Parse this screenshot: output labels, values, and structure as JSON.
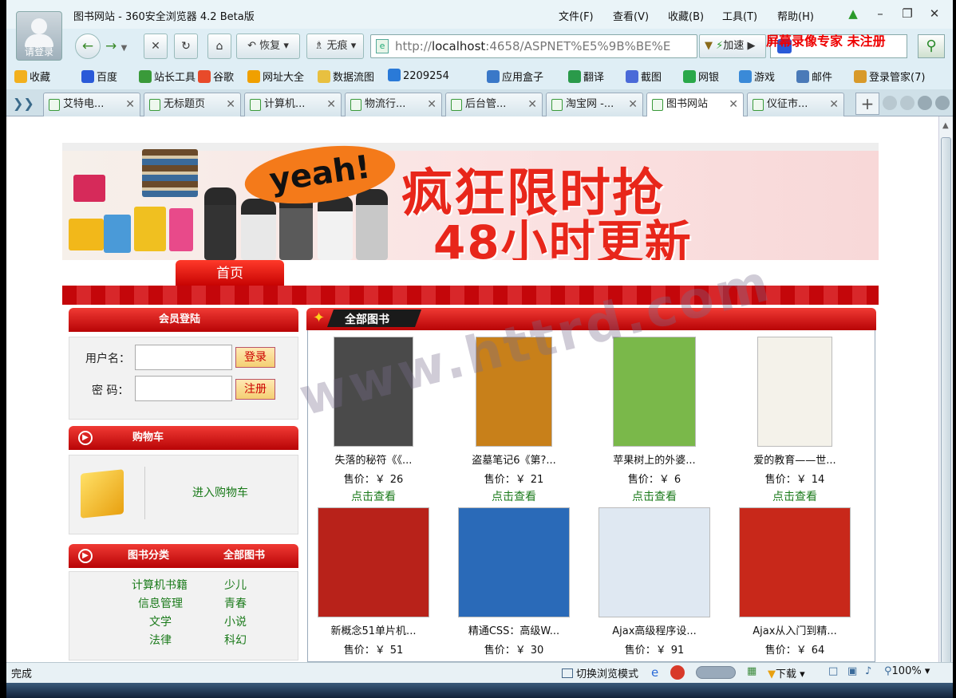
{
  "window": {
    "title": "图书网站 - 360安全浏览器 4.2 Beta版",
    "avatar_label": "请登录",
    "menus": [
      "文件(F)",
      "查看(V)",
      "收藏(B)",
      "工具(T)",
      "帮助(H)"
    ]
  },
  "toolbar": {
    "restore_label": "恢复",
    "traceless_label": "无痕",
    "url_prefix": "http://",
    "url_host": "localhost",
    "url_rest": ":4658/ASPNET%E5%9B%BE%E",
    "accelerate_label": "加速",
    "recorder_text": "屏幕录像专家  未注册"
  },
  "favorites": [
    {
      "label": "收藏",
      "icon": "star-icon",
      "color": "#f2b01e"
    },
    {
      "label": "百度",
      "icon": "baidu-icon",
      "color": "#2a5ad8"
    },
    {
      "label": "站长工具",
      "icon": "page-icon",
      "color": "#3a9a3a"
    },
    {
      "label": "谷歌",
      "icon": "google-icon",
      "color": "#e84a2a"
    },
    {
      "label": "网址大全",
      "icon": "globe-icon",
      "color": "#f0a000"
    },
    {
      "label": "数据流图",
      "icon": "doc-icon",
      "color": "#e8c040"
    },
    {
      "label": "2209254",
      "icon": "qq-icon",
      "color": "#2a7ad8"
    },
    {
      "label": "应用盒子",
      "icon": "box-icon",
      "color": "#3a78c8"
    },
    {
      "label": "翻译",
      "icon": "translate-icon",
      "color": "#2a9a4a"
    },
    {
      "label": "截图",
      "icon": "screenshot-icon",
      "color": "#4a6ad8"
    },
    {
      "label": "网银",
      "icon": "bank-icon",
      "color": "#2aa84a"
    },
    {
      "label": "游戏",
      "icon": "game-icon",
      "color": "#3a8ad8"
    },
    {
      "label": "邮件",
      "icon": "mail-icon",
      "color": "#4a7ab8"
    },
    {
      "label": "登录管家(7)",
      "icon": "key-icon",
      "color": "#d89a2a"
    }
  ],
  "tabs": [
    {
      "label": "艾特电..."
    },
    {
      "label": "无标题页"
    },
    {
      "label": "计算机..."
    },
    {
      "label": "物流行..."
    },
    {
      "label": "后台管..."
    },
    {
      "label": "淘宝网 -..."
    },
    {
      "label": "图书网站"
    },
    {
      "label": "仪征市..."
    }
  ],
  "banner": {
    "bubble": "yeah!",
    "line1": "疯狂限时抢",
    "line2": "48小时更新"
  },
  "nav": {
    "home": "首页"
  },
  "login": {
    "title": "会员登陆",
    "username_label": "用户名：",
    "password_label": "密  码：",
    "login_button": "登录",
    "register_button": "注册"
  },
  "cart": {
    "title": "购物车",
    "enter_link": "进入购物车"
  },
  "categories": {
    "title": "图书分类",
    "all_books": "全部图书",
    "items": [
      "计算机书籍",
      "少儿",
      "信息管理",
      "青春",
      "文学",
      "小说",
      "法律",
      "科幻"
    ]
  },
  "books": {
    "header": "全部图书",
    "price_label": "售价：￥",
    "view_label": "点击查看",
    "items": [
      {
        "title": "失落的秘符《《...",
        "price": "26",
        "cover": "#4a4a4a"
      },
      {
        "title": "盗墓笔记6《第?...",
        "price": "21",
        "cover": "#c8801a"
      },
      {
        "title": "苹果树上的外婆...",
        "price": "6",
        "cover": "#7ab84a"
      },
      {
        "title": "爱的教育——世...",
        "price": "14",
        "cover": "#f4f2ea"
      },
      {
        "title": "新概念51单片机...",
        "price": "51",
        "cover": "#b8221a"
      },
      {
        "title": "精通CSS：高级W...",
        "price": "30",
        "cover": "#2a6ab8"
      },
      {
        "title": "Ajax高级程序设...",
        "price": "91",
        "cover": "#dfe8f2"
      },
      {
        "title": "Ajax从入门到精...",
        "price": "64",
        "cover": "#c8281a"
      }
    ]
  },
  "watermark": "www.httrd.com",
  "status": {
    "left": "完成",
    "switch_mode": "切换浏览模式",
    "download": "下载",
    "zoom": "100%"
  }
}
